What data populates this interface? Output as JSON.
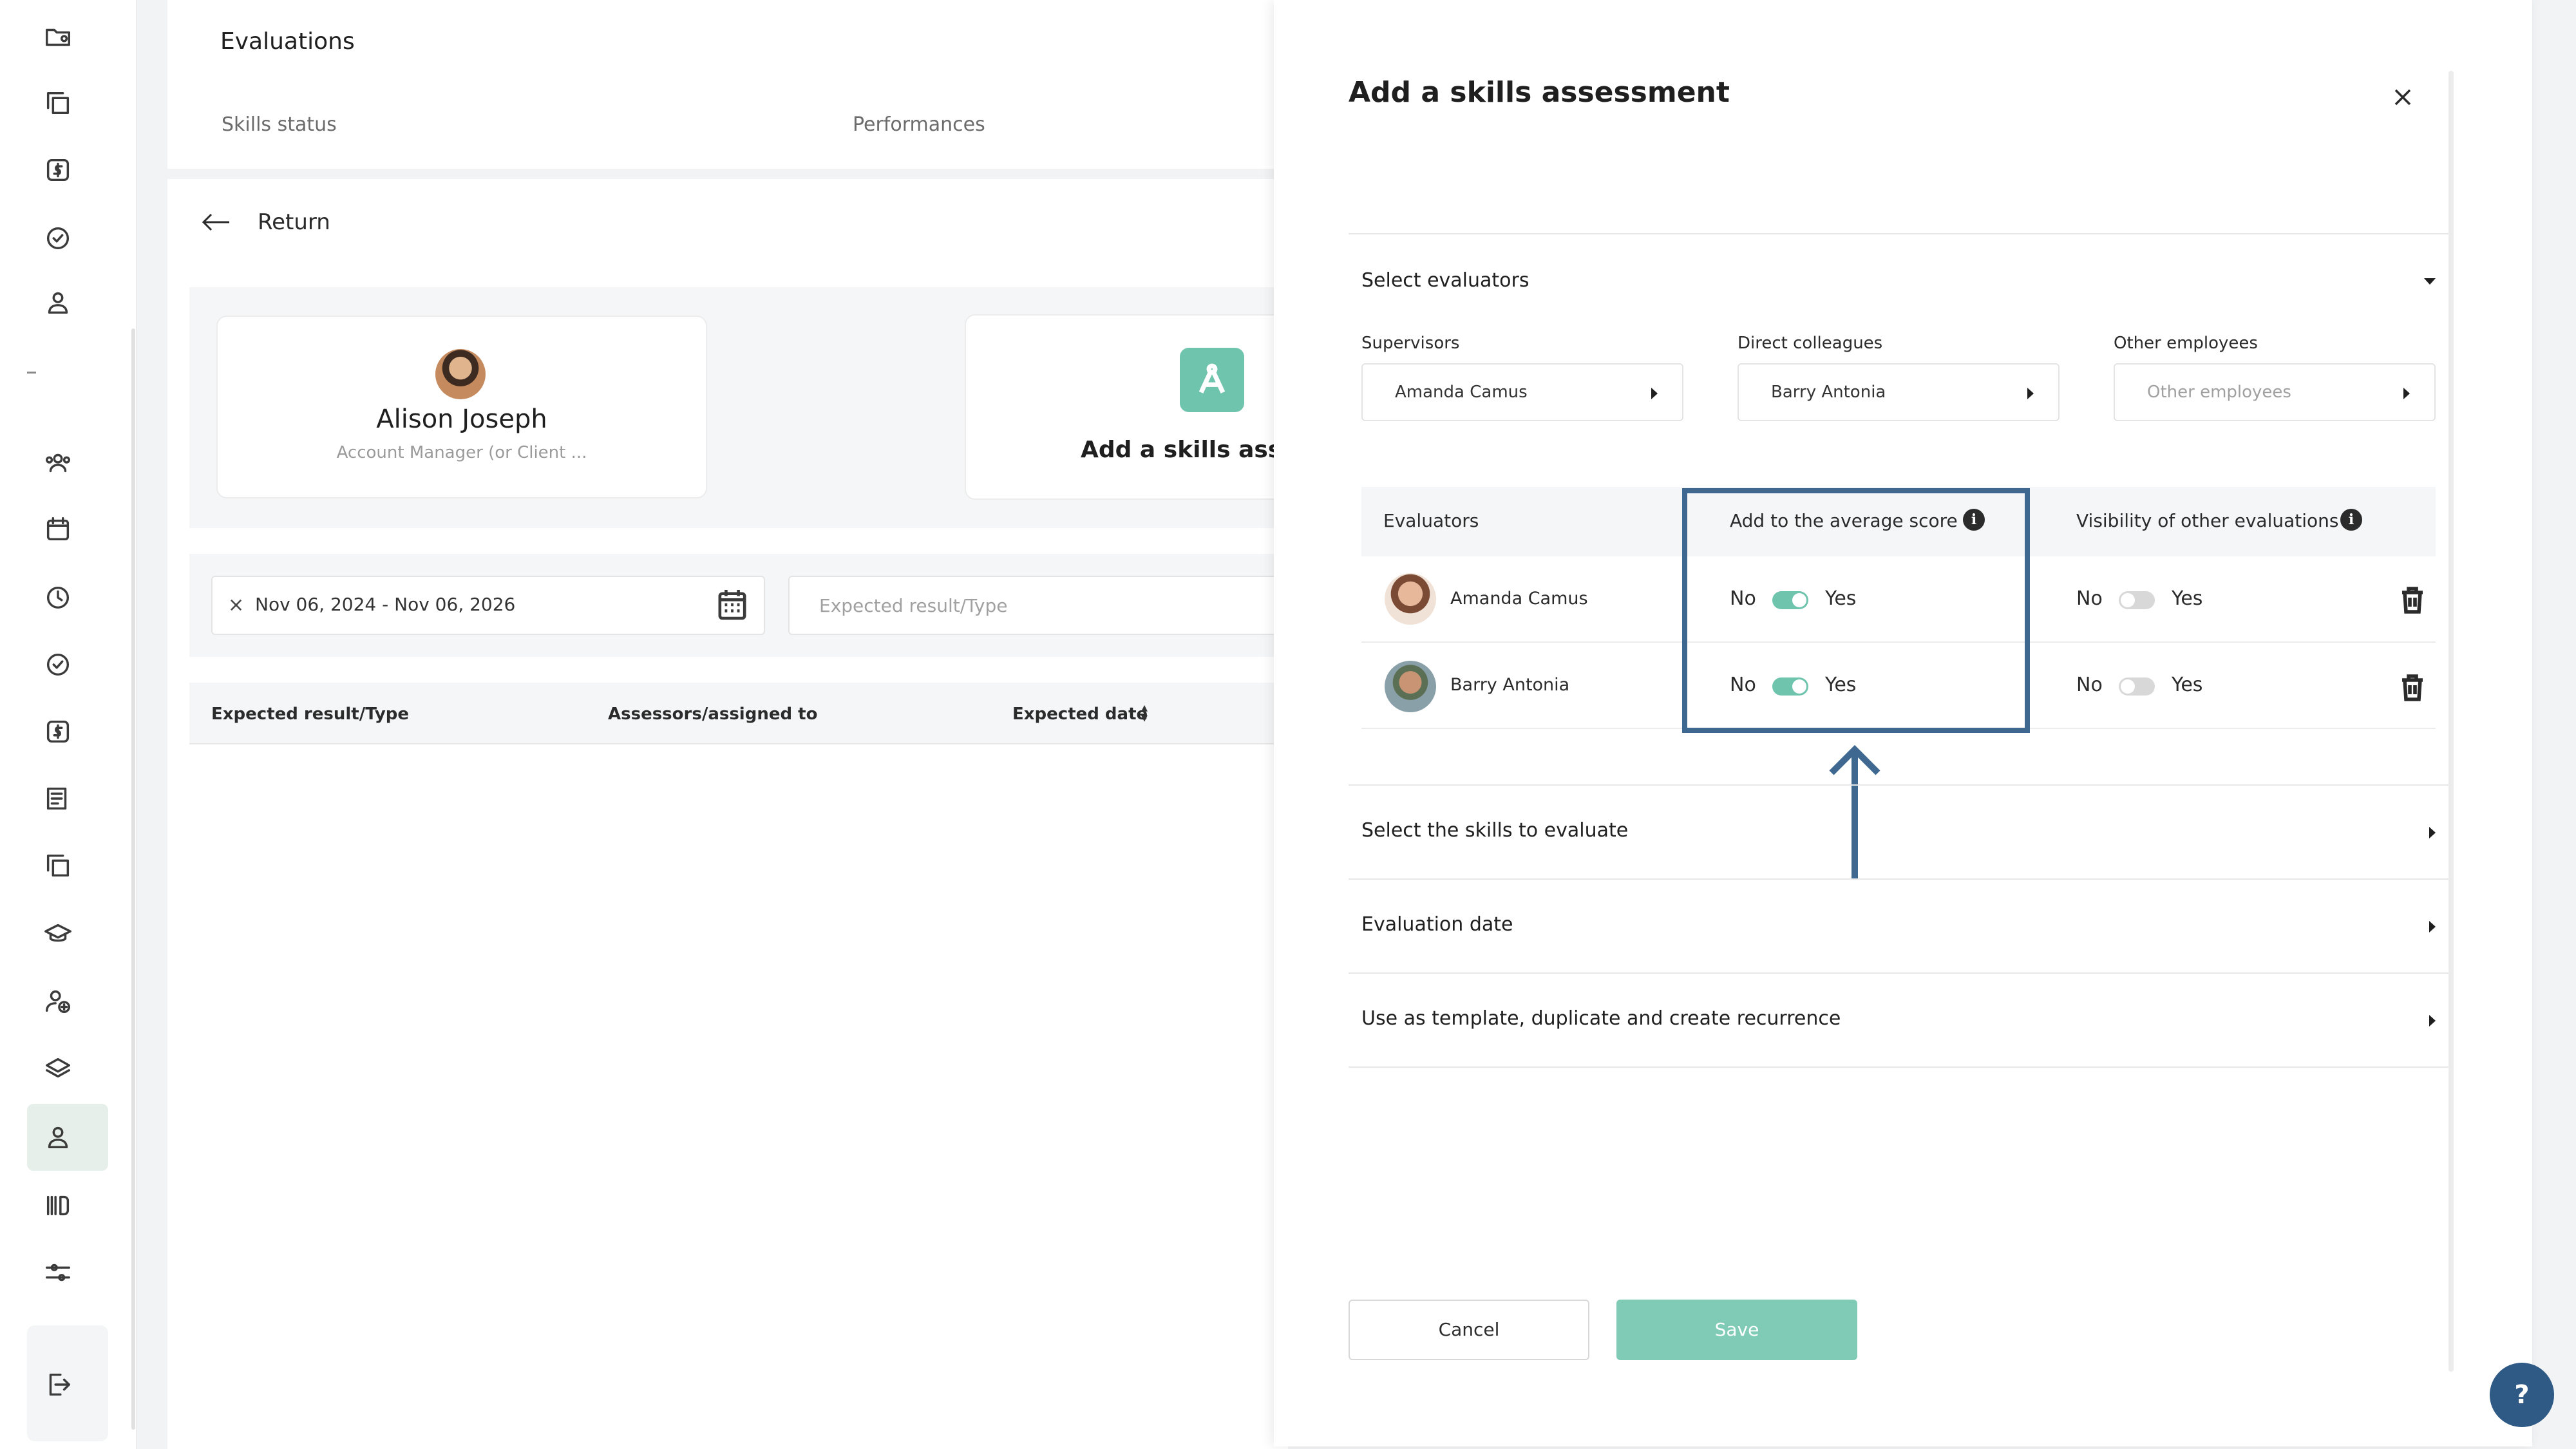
{
  "colors": {
    "accent": "#6ec4ad",
    "highlight": "#3e6890",
    "help": "#2e5a85"
  },
  "sidebar": {
    "icons": [
      "folder-user-icon",
      "copy-icon",
      "dollar-icon",
      "check-circle-icon",
      "user-icon",
      "team-icon",
      "calendar-icon",
      "clock-icon",
      "check-circle-icon",
      "dollar-icon",
      "document-icon",
      "copy-icon",
      "graduation-icon",
      "user-add-icon",
      "layers-icon",
      "user-icon",
      "barcode-icon",
      "sliders-icon",
      "logout-icon"
    ]
  },
  "header": {
    "title": "Evaluations",
    "tabs": [
      "Skills status",
      "Performances"
    ]
  },
  "main": {
    "return_label": "Return",
    "profile": {
      "name": "Alison Joseph",
      "role": "Account Manager (or Client ..."
    },
    "add_card_label": "Add a skills asses",
    "date_filter": "Nov 06, 2024 - Nov 06, 2026",
    "date_clear": "×",
    "expected_placeholder": "Expected result/Type",
    "table_headers": [
      "Expected result/Type",
      "Assessors/assigned to",
      "Expected date"
    ]
  },
  "drawer": {
    "title": "Add a skills assessment",
    "select_evaluators": "Select evaluators",
    "supervisors_label": "Supervisors",
    "supervisors_value": "Amanda Camus",
    "colleagues_label": "Direct colleagues",
    "colleagues_value": "Barry Antonia",
    "others_label": "Other employees",
    "others_placeholder": "Other employees",
    "table": {
      "col_evaluators": "Evaluators",
      "col_average": "Add to the average score",
      "col_visibility": "Visibility of other evaluations",
      "no": "No",
      "yes": "Yes",
      "rows": [
        {
          "name": "Amanda Camus",
          "average_on": true,
          "visibility_on": false
        },
        {
          "name": "Barry Antonia",
          "average_on": true,
          "visibility_on": false
        }
      ]
    },
    "select_skills": "Select the skills to evaluate",
    "evaluation_date": "Evaluation date",
    "template": "Use as template, duplicate and create recurrence",
    "cancel": "Cancel",
    "save": "Save"
  },
  "help": "?"
}
